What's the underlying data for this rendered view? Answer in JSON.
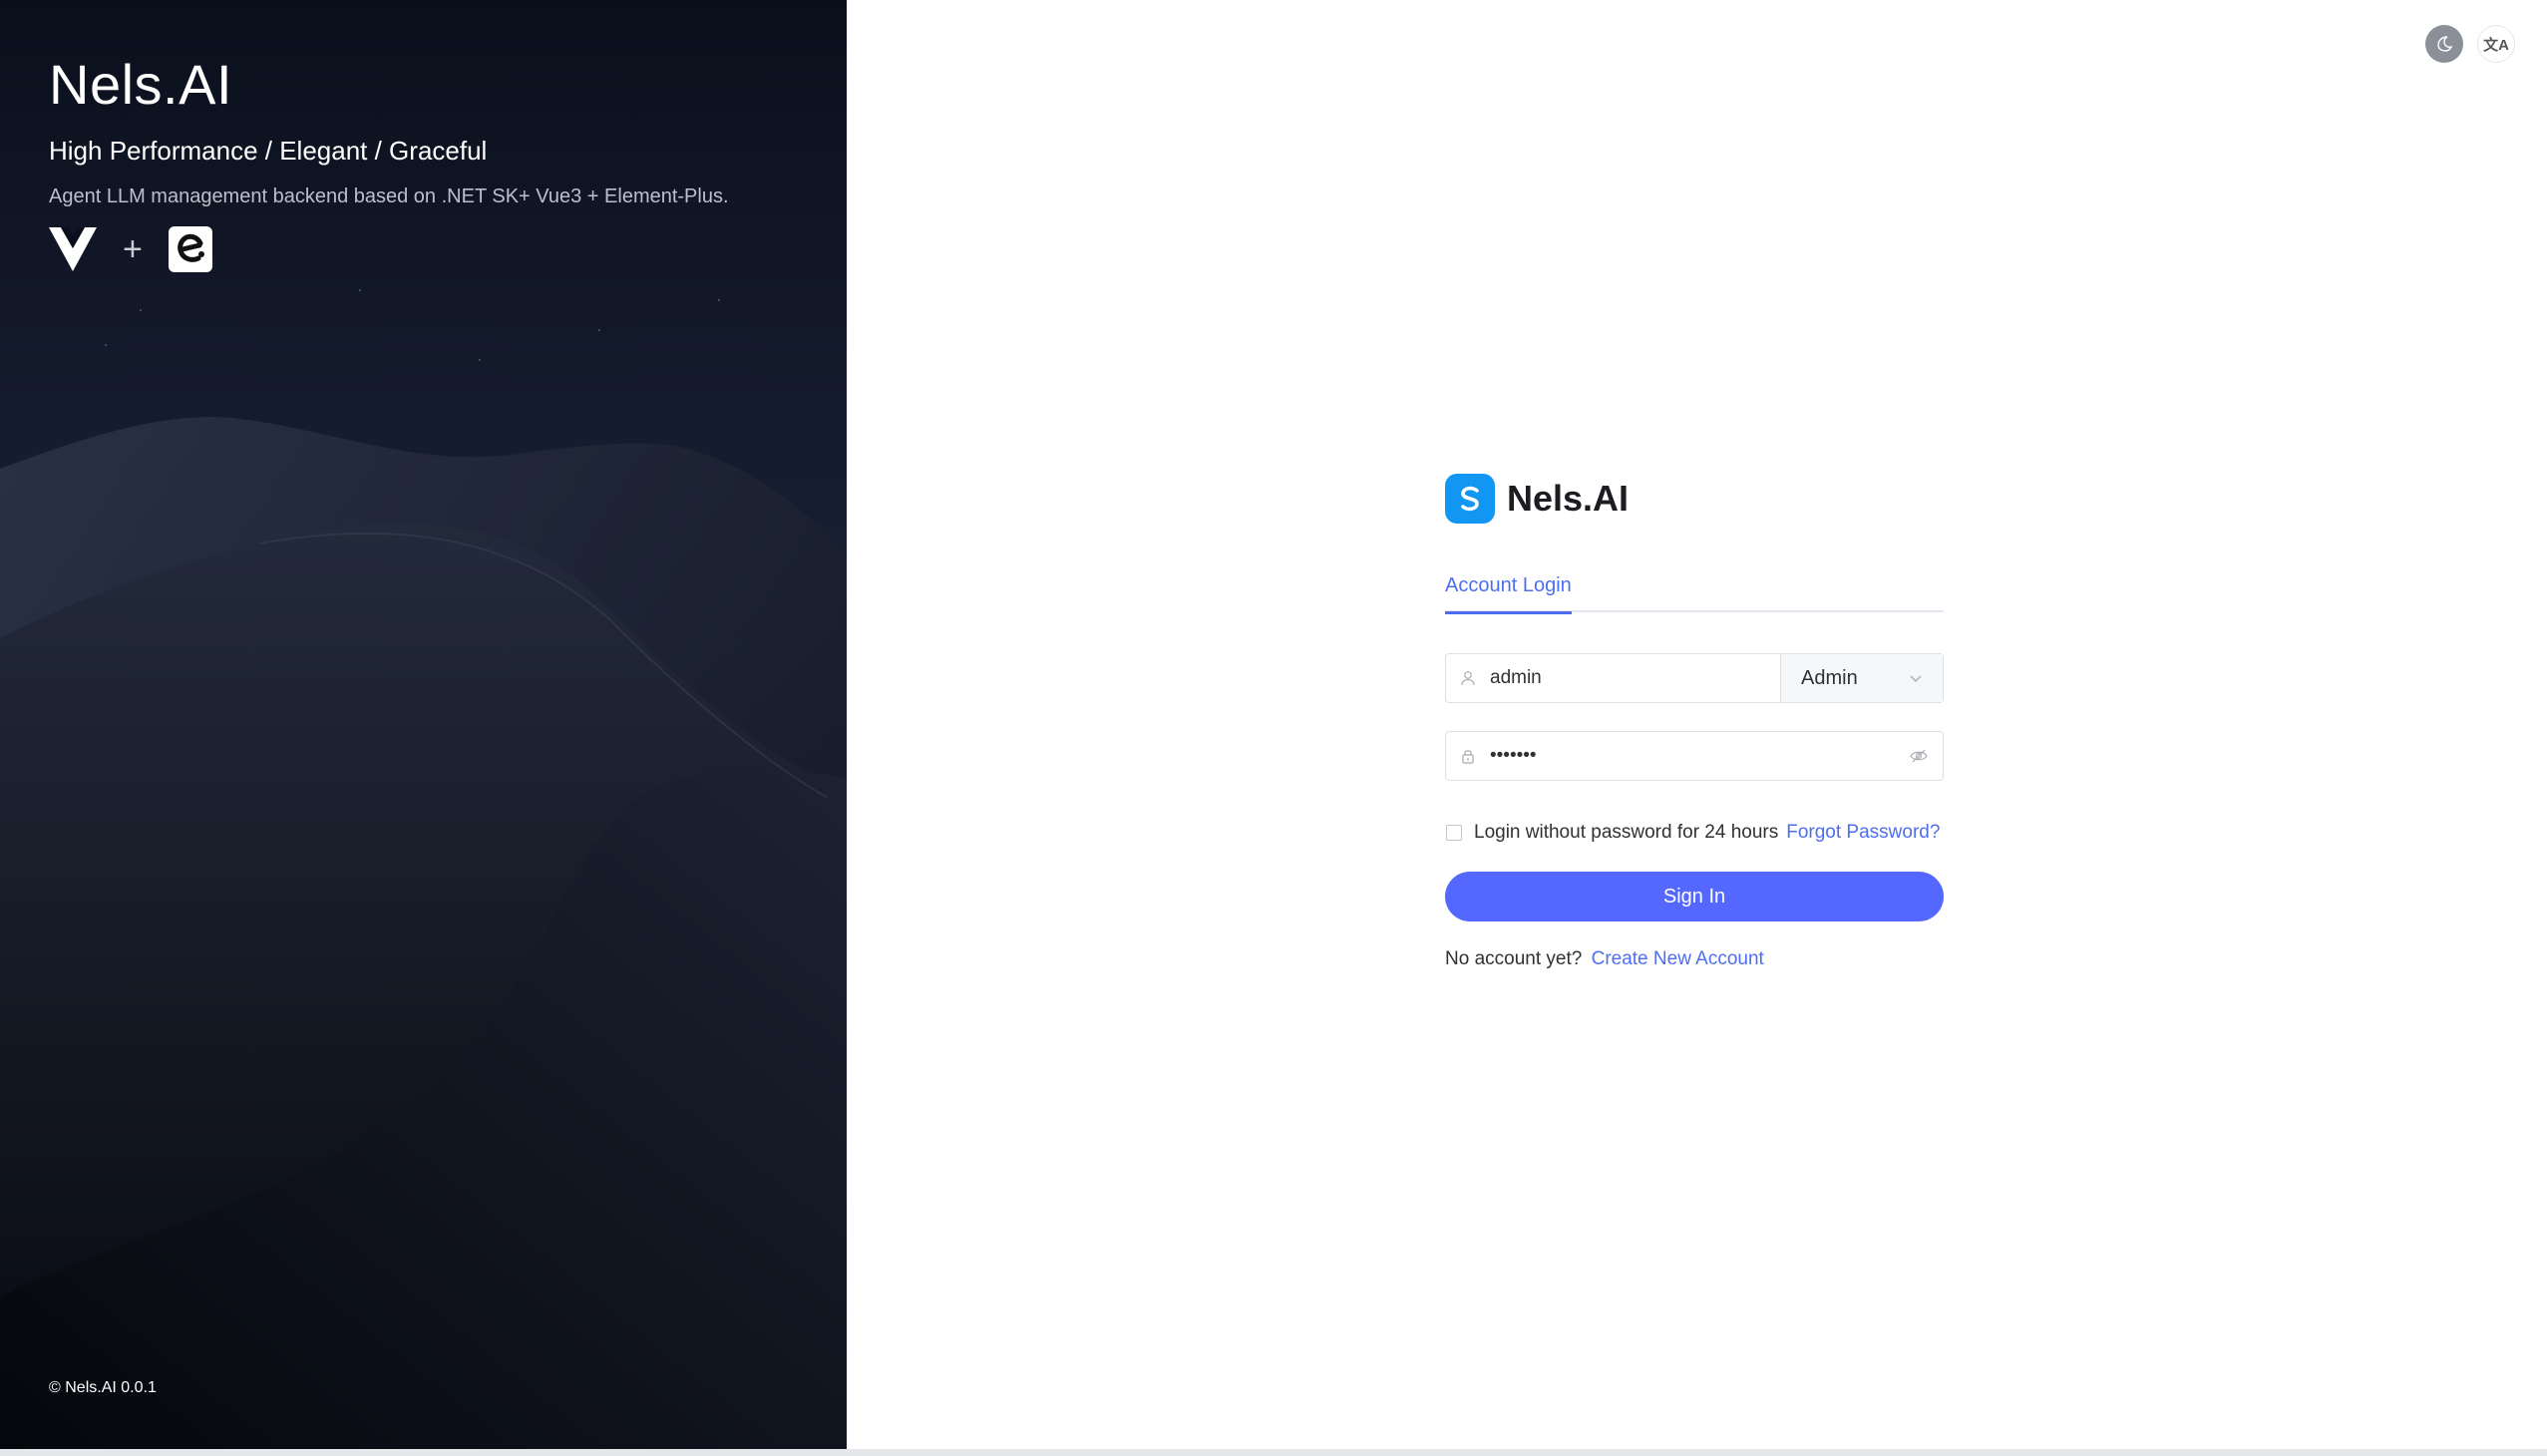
{
  "hero": {
    "title": "Nels.AI",
    "tagline": "High Performance / Elegant / Graceful",
    "description": "Agent LLM management backend based on .NET SK+ Vue3 + Element-Plus.",
    "plus": "+",
    "copyright": "© Nels.AI 0.0.1",
    "logos": [
      "vue-icon",
      "element-plus-icon"
    ]
  },
  "toolbar": {
    "theme_icon": "moon-icon",
    "language_icon": "translate-icon",
    "language_glyph": "文A"
  },
  "login": {
    "brand_name": "Nels.AI",
    "tab_label": "Account Login",
    "username_value": "admin",
    "role_value": "Admin",
    "password_value": "•••••••",
    "remember_label": "Login without password for 24 hours",
    "forgot_label": "Forgot Password?",
    "submit_label": "Sign In",
    "no_account_text": "No account yet?",
    "register_label": "Create New Account"
  },
  "colors": {
    "accent": "#4e6ef2",
    "button": "#5468ff",
    "brand": "#1296f3"
  }
}
